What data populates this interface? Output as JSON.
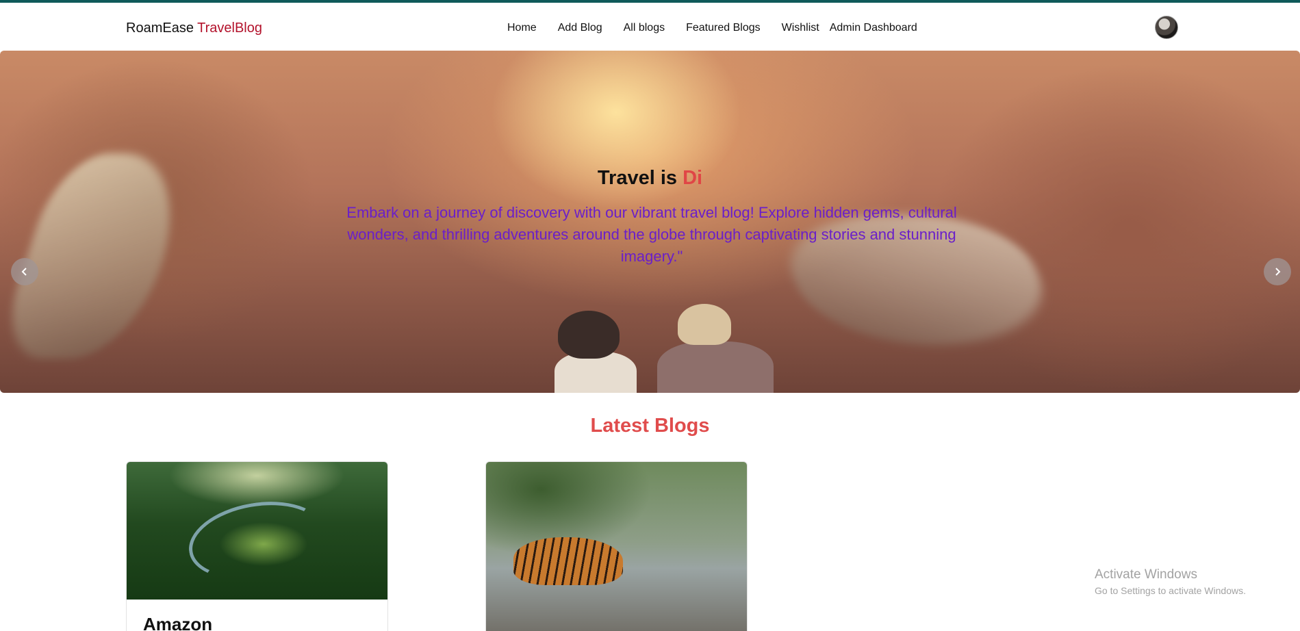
{
  "brand": {
    "name": "RoamEase",
    "accent": "TravelBlog"
  },
  "nav": {
    "items": [
      {
        "label": "Home"
      },
      {
        "label": "Add Blog"
      },
      {
        "label": "All blogs"
      },
      {
        "label": "Featured Blogs"
      },
      {
        "label": "Wishlist"
      },
      {
        "label": "Admin Dashboard"
      }
    ]
  },
  "hero": {
    "title_prefix": "Travel is ",
    "title_typed": "Di",
    "text": "Embark on a journey of discovery with our vibrant travel blog! Explore hidden gems, cultural wonders, and thrilling adventures around the globe through captivating stories and stunning imagery.\"",
    "prev_icon": "chevron-left-icon",
    "next_icon": "chevron-right-icon",
    "slides": 2,
    "active_slide": 2
  },
  "latest": {
    "title": "Latest Blogs",
    "cards": [
      {
        "title": "Amazon"
      },
      {
        "title": ""
      }
    ]
  },
  "watermark": {
    "title": "Activate Windows",
    "subtitle": "Go to Settings to activate Windows."
  },
  "colors": {
    "top_strip": "#0f5a5a",
    "brand_accent": "#b3122b",
    "hero_typed": "#e04646",
    "hero_text": "#6a1fc9",
    "section_title": "#e04c4c"
  }
}
